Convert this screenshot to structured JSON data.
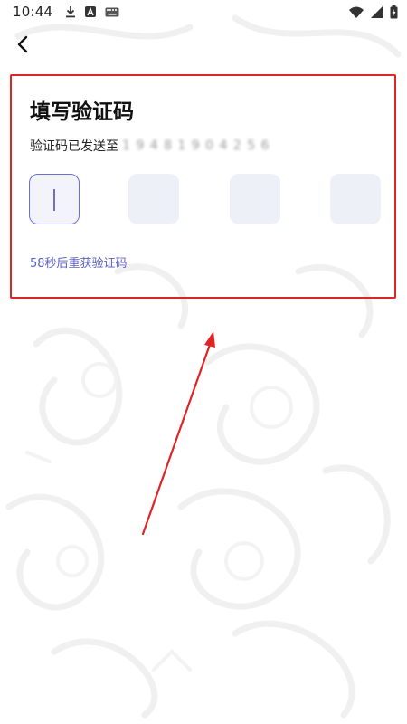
{
  "status_bar": {
    "time": "10:44",
    "left_icons": [
      "download-icon",
      "font-a-icon",
      "keyboard-icon"
    ],
    "right_icons": [
      "wifi-icon",
      "signal-icon",
      "battery-charging-icon"
    ]
  },
  "nav": {
    "back_icon": "chevron-left-icon"
  },
  "verify": {
    "title": "填写验证码",
    "sent_label": "验证码已发送至",
    "masked_phone": "1 9 4 8 1 9 0 4 2 5 6",
    "code_slots": 4,
    "active_slot": 0,
    "resend_text": "58秒后重获验证码"
  },
  "colors": {
    "accent": "#5b5fc7",
    "box_fill": "#eef0f8",
    "annotation_red": "#e02424"
  }
}
